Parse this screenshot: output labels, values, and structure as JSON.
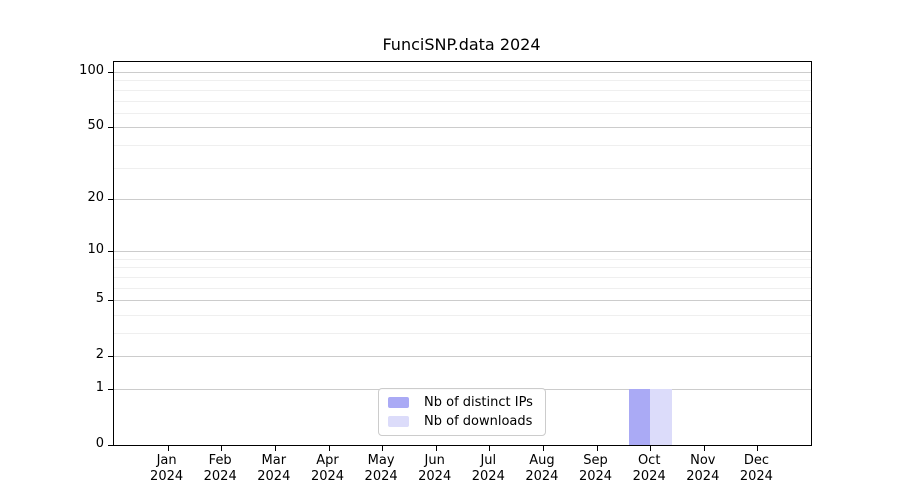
{
  "chart_data": {
    "type": "bar",
    "title": "FunciSNP.data 2024",
    "x_categories": [
      "Jan",
      "Feb",
      "Mar",
      "Apr",
      "May",
      "Jun",
      "Jul",
      "Aug",
      "Sep",
      "Oct",
      "Nov",
      "Dec"
    ],
    "x_year_label": "2024",
    "series": [
      {
        "name": "Nb of distinct IPs",
        "color": "#aaaaf5",
        "values": [
          0,
          0,
          0,
          0,
          0,
          0,
          0,
          0,
          0,
          1,
          0,
          0
        ]
      },
      {
        "name": "Nb of downloads",
        "color": "#dcdcfa",
        "values": [
          0,
          0,
          0,
          0,
          0,
          0,
          0,
          0,
          0,
          1,
          0,
          0
        ]
      }
    ],
    "y_axis": {
      "scale": "log1p",
      "min": 0,
      "max": 100,
      "major_ticks": [
        0,
        1,
        2,
        5,
        10,
        20,
        50,
        100
      ],
      "minor_gridlines": [
        3,
        4,
        6,
        7,
        8,
        9,
        30,
        40,
        60,
        70,
        80,
        90
      ]
    },
    "grid": true,
    "legend": {
      "position": "lower center"
    },
    "colors": {
      "axis": "#000000",
      "major_grid": "#cccccc",
      "minor_grid": "#efefef",
      "legend_border": "#cccccc"
    }
  }
}
